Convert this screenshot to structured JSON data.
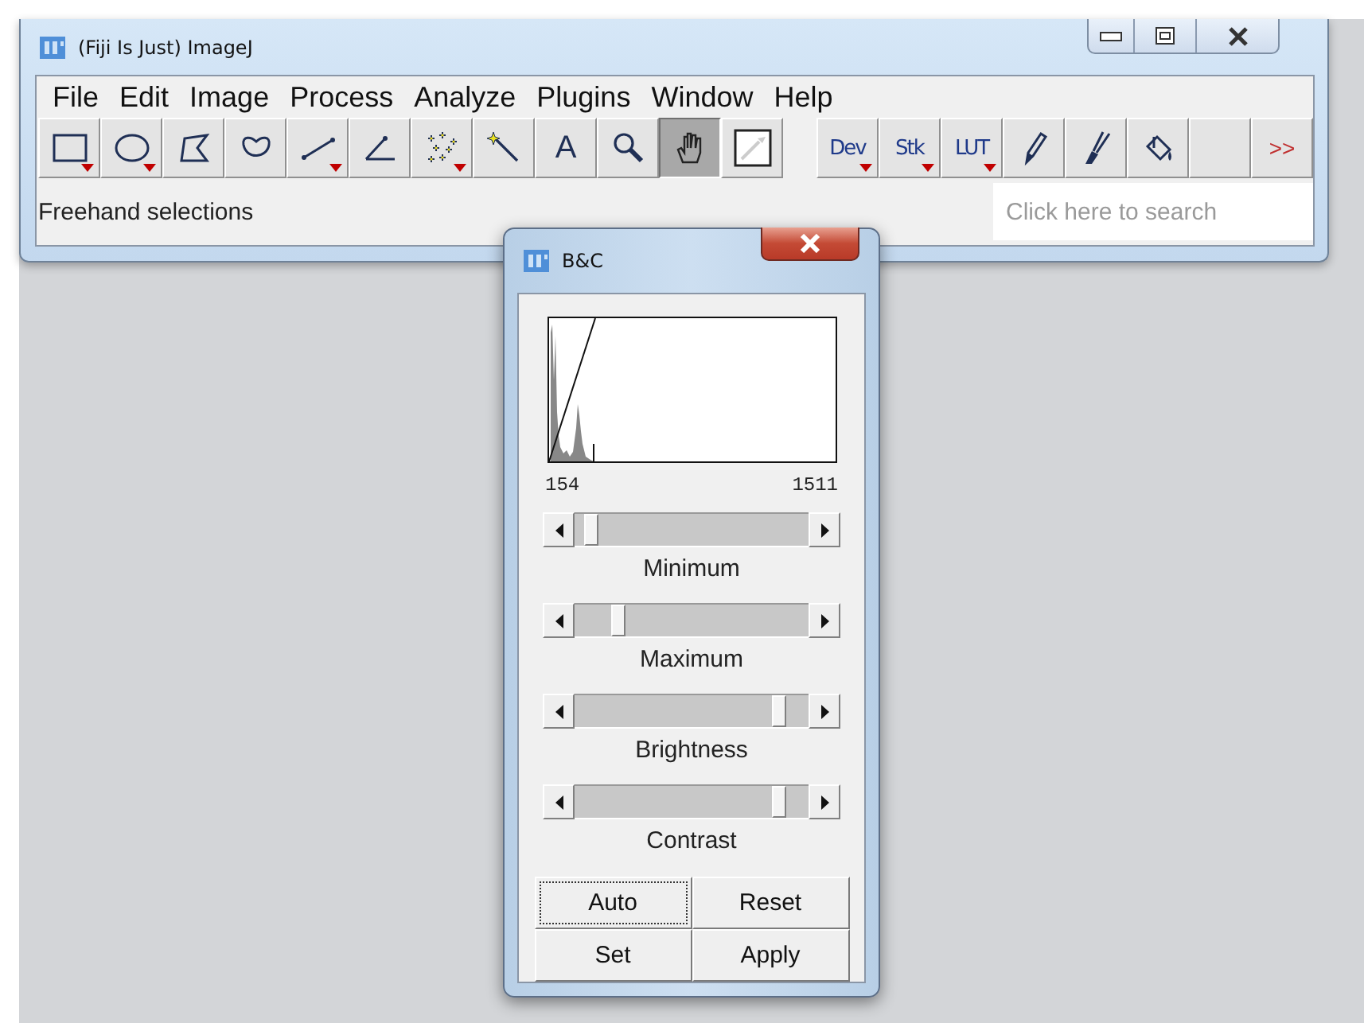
{
  "main_window": {
    "title": "(Fiji Is Just) ImageJ",
    "menu": [
      "File",
      "Edit",
      "Image",
      "Process",
      "Analyze",
      "Plugins",
      "Window",
      "Help"
    ],
    "toolbar_left": [
      {
        "kind": "rectangle",
        "has_menu": true,
        "selected": false
      },
      {
        "kind": "oval",
        "has_menu": true,
        "selected": false
      },
      {
        "kind": "polygon",
        "has_menu": false,
        "selected": false
      },
      {
        "kind": "freehand",
        "has_menu": false,
        "selected": false
      },
      {
        "kind": "line",
        "has_menu": true,
        "selected": false
      },
      {
        "kind": "angle",
        "has_menu": false,
        "selected": false
      },
      {
        "kind": "point",
        "has_menu": true,
        "selected": false
      },
      {
        "kind": "wand",
        "has_menu": false,
        "selected": false
      },
      {
        "kind": "text",
        "label": "A",
        "has_menu": false,
        "selected": false
      },
      {
        "kind": "magnifier",
        "has_menu": false,
        "selected": false
      },
      {
        "kind": "hand",
        "has_menu": false,
        "selected": true
      },
      {
        "kind": "dropper",
        "has_menu": false,
        "selected": false
      }
    ],
    "toolbar_right": [
      {
        "kind": "label",
        "label": "Dev",
        "has_menu": true,
        "selected": false
      },
      {
        "kind": "label",
        "label": "Stk",
        "has_menu": true,
        "selected": false
      },
      {
        "kind": "label",
        "label": "LUT",
        "has_menu": true,
        "selected": false
      },
      {
        "kind": "pencil",
        "has_menu": false,
        "selected": false
      },
      {
        "kind": "brush",
        "has_menu": false,
        "selected": false
      },
      {
        "kind": "fill",
        "has_menu": false,
        "selected": false
      },
      {
        "kind": "blank",
        "has_menu": false,
        "selected": false
      },
      {
        "kind": "more",
        "label": ">>",
        "has_menu": false,
        "selected": false
      }
    ],
    "status": "Freehand selections",
    "search": {
      "placeholder": "Click here to search"
    }
  },
  "dialog": {
    "title": "B&C",
    "range_min": "154",
    "range_max": "1511",
    "sliders": [
      {
        "label": "Minimum",
        "level": 0.04
      },
      {
        "label": "Maximum",
        "level": 0.17
      },
      {
        "label": "Brightness",
        "level": 0.9
      },
      {
        "label": "Contrast",
        "level": 0.9
      }
    ],
    "buttons": [
      {
        "label": "Auto",
        "focused": true
      },
      {
        "label": "Reset",
        "focused": false
      },
      {
        "label": "Set",
        "focused": false
      },
      {
        "label": "Apply",
        "focused": false
      }
    ]
  }
}
